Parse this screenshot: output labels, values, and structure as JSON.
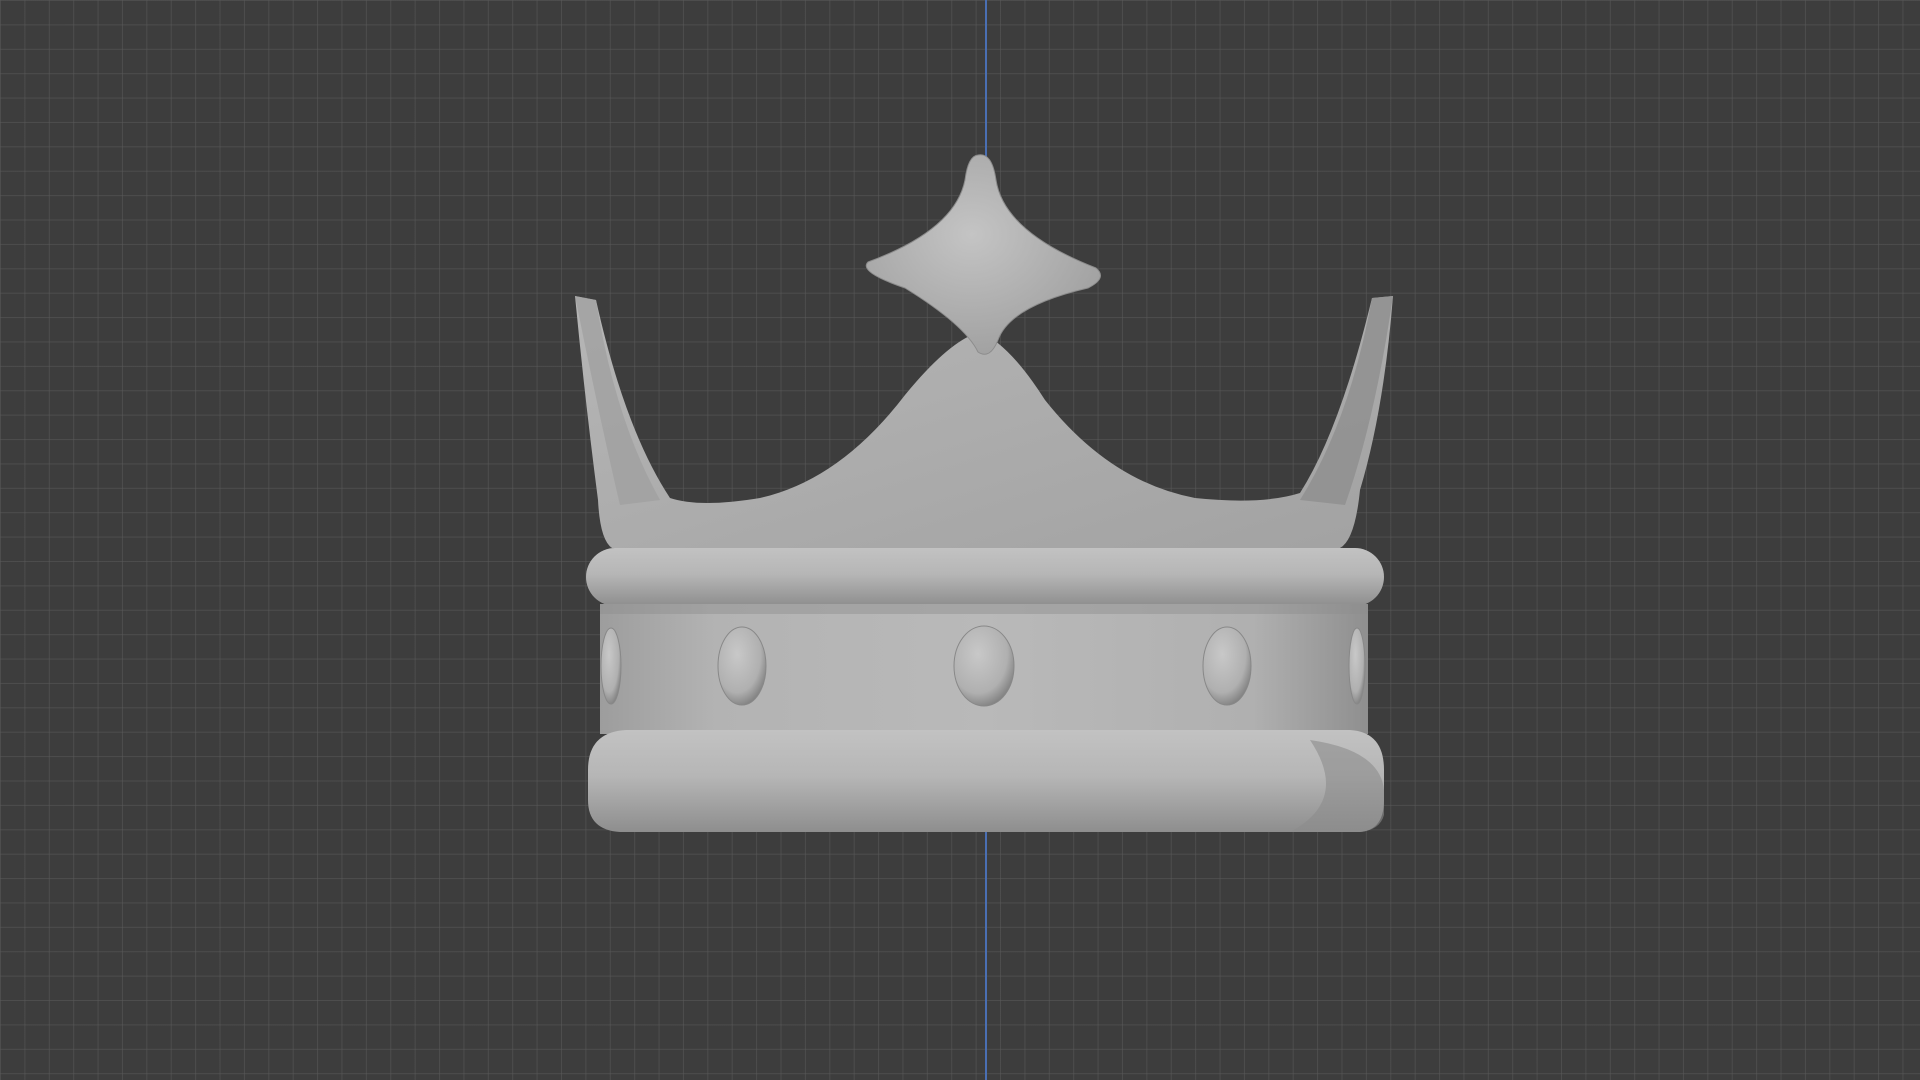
{
  "app": {
    "view": "3D Viewport",
    "shading": "solid"
  },
  "viewport": {
    "background_color": "#3d3d3d",
    "grid_color": "#5a5a5a",
    "axis_z_color": "#4a6fb3"
  },
  "object": {
    "icon": "crown-icon",
    "material_color": "#a9a9a9",
    "gems_count": 5
  }
}
